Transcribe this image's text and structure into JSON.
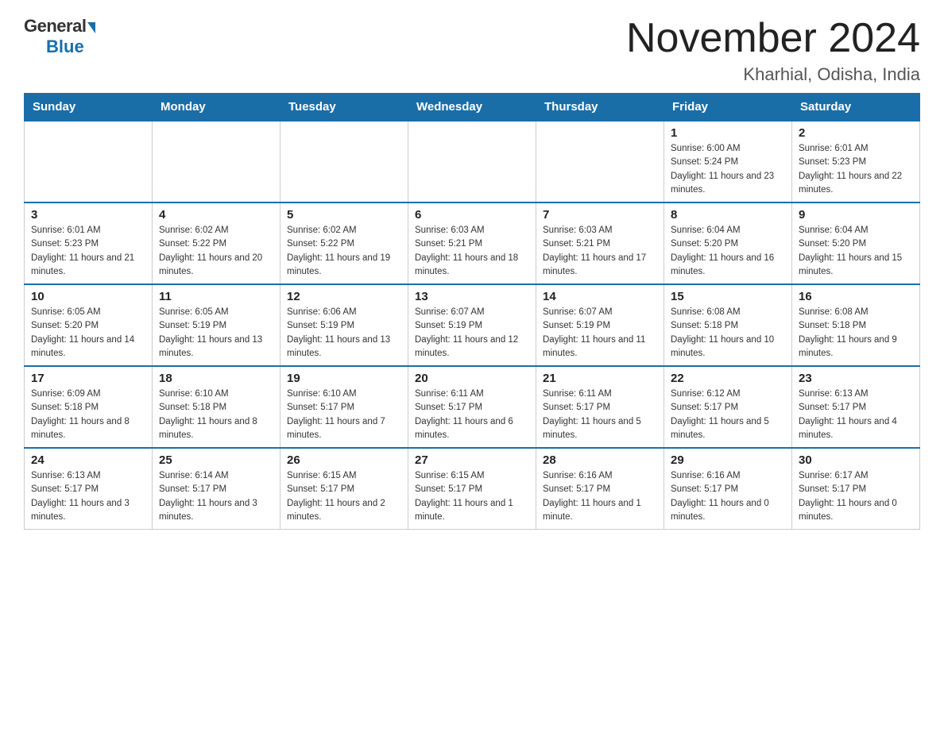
{
  "header": {
    "logo_general": "General",
    "logo_blue": "Blue",
    "month_title": "November 2024",
    "location": "Kharhial, Odisha, India"
  },
  "days_of_week": [
    "Sunday",
    "Monday",
    "Tuesday",
    "Wednesday",
    "Thursday",
    "Friday",
    "Saturday"
  ],
  "weeks": [
    [
      {
        "day": "",
        "info": ""
      },
      {
        "day": "",
        "info": ""
      },
      {
        "day": "",
        "info": ""
      },
      {
        "day": "",
        "info": ""
      },
      {
        "day": "",
        "info": ""
      },
      {
        "day": "1",
        "info": "Sunrise: 6:00 AM\nSunset: 5:24 PM\nDaylight: 11 hours and 23 minutes."
      },
      {
        "day": "2",
        "info": "Sunrise: 6:01 AM\nSunset: 5:23 PM\nDaylight: 11 hours and 22 minutes."
      }
    ],
    [
      {
        "day": "3",
        "info": "Sunrise: 6:01 AM\nSunset: 5:23 PM\nDaylight: 11 hours and 21 minutes."
      },
      {
        "day": "4",
        "info": "Sunrise: 6:02 AM\nSunset: 5:22 PM\nDaylight: 11 hours and 20 minutes."
      },
      {
        "day": "5",
        "info": "Sunrise: 6:02 AM\nSunset: 5:22 PM\nDaylight: 11 hours and 19 minutes."
      },
      {
        "day": "6",
        "info": "Sunrise: 6:03 AM\nSunset: 5:21 PM\nDaylight: 11 hours and 18 minutes."
      },
      {
        "day": "7",
        "info": "Sunrise: 6:03 AM\nSunset: 5:21 PM\nDaylight: 11 hours and 17 minutes."
      },
      {
        "day": "8",
        "info": "Sunrise: 6:04 AM\nSunset: 5:20 PM\nDaylight: 11 hours and 16 minutes."
      },
      {
        "day": "9",
        "info": "Sunrise: 6:04 AM\nSunset: 5:20 PM\nDaylight: 11 hours and 15 minutes."
      }
    ],
    [
      {
        "day": "10",
        "info": "Sunrise: 6:05 AM\nSunset: 5:20 PM\nDaylight: 11 hours and 14 minutes."
      },
      {
        "day": "11",
        "info": "Sunrise: 6:05 AM\nSunset: 5:19 PM\nDaylight: 11 hours and 13 minutes."
      },
      {
        "day": "12",
        "info": "Sunrise: 6:06 AM\nSunset: 5:19 PM\nDaylight: 11 hours and 13 minutes."
      },
      {
        "day": "13",
        "info": "Sunrise: 6:07 AM\nSunset: 5:19 PM\nDaylight: 11 hours and 12 minutes."
      },
      {
        "day": "14",
        "info": "Sunrise: 6:07 AM\nSunset: 5:19 PM\nDaylight: 11 hours and 11 minutes."
      },
      {
        "day": "15",
        "info": "Sunrise: 6:08 AM\nSunset: 5:18 PM\nDaylight: 11 hours and 10 minutes."
      },
      {
        "day": "16",
        "info": "Sunrise: 6:08 AM\nSunset: 5:18 PM\nDaylight: 11 hours and 9 minutes."
      }
    ],
    [
      {
        "day": "17",
        "info": "Sunrise: 6:09 AM\nSunset: 5:18 PM\nDaylight: 11 hours and 8 minutes."
      },
      {
        "day": "18",
        "info": "Sunrise: 6:10 AM\nSunset: 5:18 PM\nDaylight: 11 hours and 8 minutes."
      },
      {
        "day": "19",
        "info": "Sunrise: 6:10 AM\nSunset: 5:17 PM\nDaylight: 11 hours and 7 minutes."
      },
      {
        "day": "20",
        "info": "Sunrise: 6:11 AM\nSunset: 5:17 PM\nDaylight: 11 hours and 6 minutes."
      },
      {
        "day": "21",
        "info": "Sunrise: 6:11 AM\nSunset: 5:17 PM\nDaylight: 11 hours and 5 minutes."
      },
      {
        "day": "22",
        "info": "Sunrise: 6:12 AM\nSunset: 5:17 PM\nDaylight: 11 hours and 5 minutes."
      },
      {
        "day": "23",
        "info": "Sunrise: 6:13 AM\nSunset: 5:17 PM\nDaylight: 11 hours and 4 minutes."
      }
    ],
    [
      {
        "day": "24",
        "info": "Sunrise: 6:13 AM\nSunset: 5:17 PM\nDaylight: 11 hours and 3 minutes."
      },
      {
        "day": "25",
        "info": "Sunrise: 6:14 AM\nSunset: 5:17 PM\nDaylight: 11 hours and 3 minutes."
      },
      {
        "day": "26",
        "info": "Sunrise: 6:15 AM\nSunset: 5:17 PM\nDaylight: 11 hours and 2 minutes."
      },
      {
        "day": "27",
        "info": "Sunrise: 6:15 AM\nSunset: 5:17 PM\nDaylight: 11 hours and 1 minute."
      },
      {
        "day": "28",
        "info": "Sunrise: 6:16 AM\nSunset: 5:17 PM\nDaylight: 11 hours and 1 minute."
      },
      {
        "day": "29",
        "info": "Sunrise: 6:16 AM\nSunset: 5:17 PM\nDaylight: 11 hours and 0 minutes."
      },
      {
        "day": "30",
        "info": "Sunrise: 6:17 AM\nSunset: 5:17 PM\nDaylight: 11 hours and 0 minutes."
      }
    ]
  ]
}
